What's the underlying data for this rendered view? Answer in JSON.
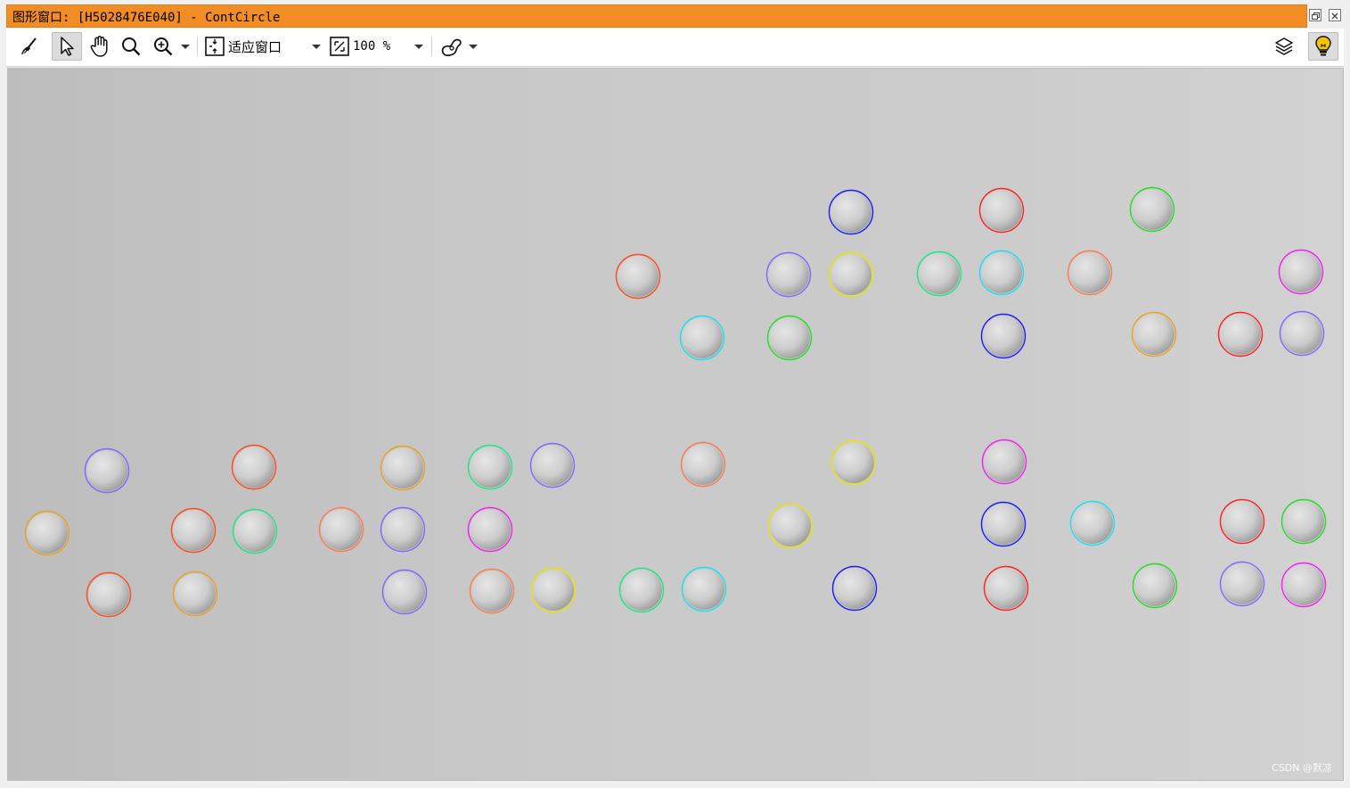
{
  "window": {
    "title": "图形窗口: [H5028476E040] - ContCircle",
    "title_color": "#f28c24"
  },
  "toolbar": {
    "icons": [
      "broom-icon",
      "pointer-icon",
      "hand-icon",
      "magnifier-icon",
      "zoom-in-icon",
      "fit-window-icon",
      "zoom-percent-icon",
      "draw-shape-icon",
      "layers-icon",
      "lightbulb-icon"
    ],
    "fit_label": "适应窗口",
    "zoom_value": "100 %"
  },
  "canvas": {
    "watermark": "CSDN @默凉",
    "circles": [
      {
        "color": "#1a1aff"
      },
      {
        "color": "#ff2020"
      },
      {
        "color": "#22dd22"
      },
      {
        "color": "#ff4a1a"
      },
      {
        "color": "#7a6aff"
      },
      {
        "color": "#e6e600"
      },
      {
        "color": "#18e888"
      },
      {
        "color": "#18e0f0"
      },
      {
        "color": "#ff7a4a"
      },
      {
        "color": "#ee22ee"
      },
      {
        "color": "#18e0f0"
      },
      {
        "color": "#22dd22"
      },
      {
        "color": "#1a1aff"
      },
      {
        "color": "#eea020"
      },
      {
        "color": "#ff2020"
      },
      {
        "color": "#7a6aff"
      },
      {
        "color": "#7a6aff"
      },
      {
        "color": "#ff4a1a"
      },
      {
        "color": "#eea020"
      },
      {
        "color": "#18e888"
      },
      {
        "color": "#7a6aff"
      },
      {
        "color": "#ff7a4a"
      },
      {
        "color": "#e6e600"
      },
      {
        "color": "#ee22ee"
      },
      {
        "color": "#eea020"
      },
      {
        "color": "#ff4a1a"
      },
      {
        "color": "#18e888"
      },
      {
        "color": "#ff7a4a"
      },
      {
        "color": "#7a6aff"
      },
      {
        "color": "#ee22ee"
      },
      {
        "color": "#e6e600"
      },
      {
        "color": "#1a1aff"
      },
      {
        "color": "#18e0f0"
      },
      {
        "color": "#ff2020"
      },
      {
        "color": "#22dd22"
      },
      {
        "color": "#ff4a1a"
      },
      {
        "color": "#eea020"
      },
      {
        "color": "#7a6aff"
      },
      {
        "color": "#ff7a4a"
      },
      {
        "color": "#e6e600"
      },
      {
        "color": "#18e888"
      },
      {
        "color": "#18e0f0"
      },
      {
        "color": "#1a1aff"
      },
      {
        "color": "#ff2020"
      },
      {
        "color": "#22dd22"
      },
      {
        "color": "#7a6aff"
      },
      {
        "color": "#ee22ee"
      }
    ]
  }
}
